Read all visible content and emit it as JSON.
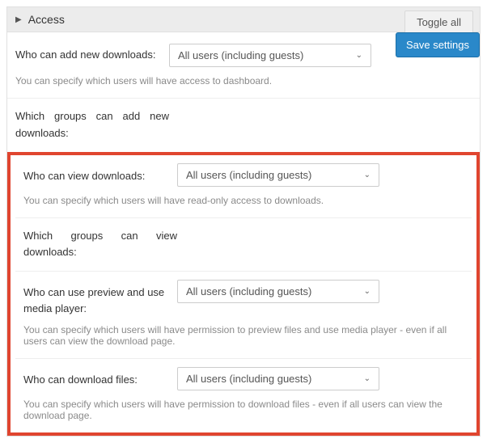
{
  "panel": {
    "title": "Access",
    "toggle_all": "Toggle all",
    "save_button": "Save settings"
  },
  "select_default": "All users (including guests)",
  "rows": {
    "add_downloads": {
      "label": "Who can add new downloads:",
      "help": "You can specify which users will have access to dashboard."
    },
    "groups_add": {
      "label": "Which groups can add new downloads:"
    },
    "view_downloads": {
      "label": "Who can view downloads:",
      "help": "You can specify which users will have read-only access to downloads."
    },
    "groups_view": {
      "label": "Which groups can view downloads:"
    },
    "preview": {
      "label": "Who can use preview and use media player:",
      "help": "You can specify which users will have permission to preview files and use media player - even if all users can view the download page."
    },
    "download_files": {
      "label": "Who can download files:",
      "help": "You can specify which users will have permission to download files - even if all users can view the download page."
    }
  }
}
